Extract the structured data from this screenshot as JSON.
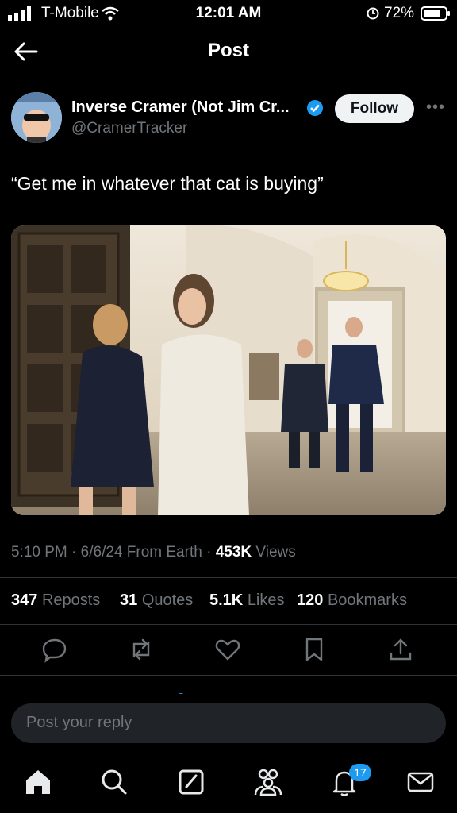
{
  "status_bar": {
    "carrier": "T-Mobile",
    "time": "12:01 AM",
    "battery": "72%"
  },
  "header": {
    "title": "Post"
  },
  "author": {
    "name": "Inverse Cramer (Not Jim Cr...",
    "handle": "@CramerTracker",
    "follow_label": "Follow"
  },
  "tweet": {
    "text": "“Get me in whatever that cat is buying”"
  },
  "meta": {
    "time": "5:10 PM",
    "date": "6/6/24",
    "source": "From Earth",
    "views_count": "453K",
    "views_label": "Views"
  },
  "stats": {
    "reposts_count": "347",
    "reposts_label": "Reposts",
    "quotes_count": "31",
    "quotes_label": "Quotes",
    "likes_count": "5.1K",
    "likes_label": "Likes",
    "bookmarks_count": "120",
    "bookmarks_label": "Bookmarks"
  },
  "reply": {
    "placeholder": "Post your reply"
  },
  "nav": {
    "notifications_badge": "17"
  },
  "icons": [
    "signal-icon",
    "wifi-icon",
    "alarm-icon",
    "battery-icon",
    "back-arrow-icon",
    "verified-icon",
    "more-icon",
    "reply-icon",
    "repost-icon",
    "like-icon",
    "bookmark-icon",
    "share-icon",
    "home-icon",
    "search-icon",
    "compose-icon",
    "communities-icon",
    "notifications-icon",
    "messages-icon"
  ],
  "colors": {
    "accent": "#1d9bf0",
    "text_secondary": "#71767b",
    "background": "#000000"
  }
}
